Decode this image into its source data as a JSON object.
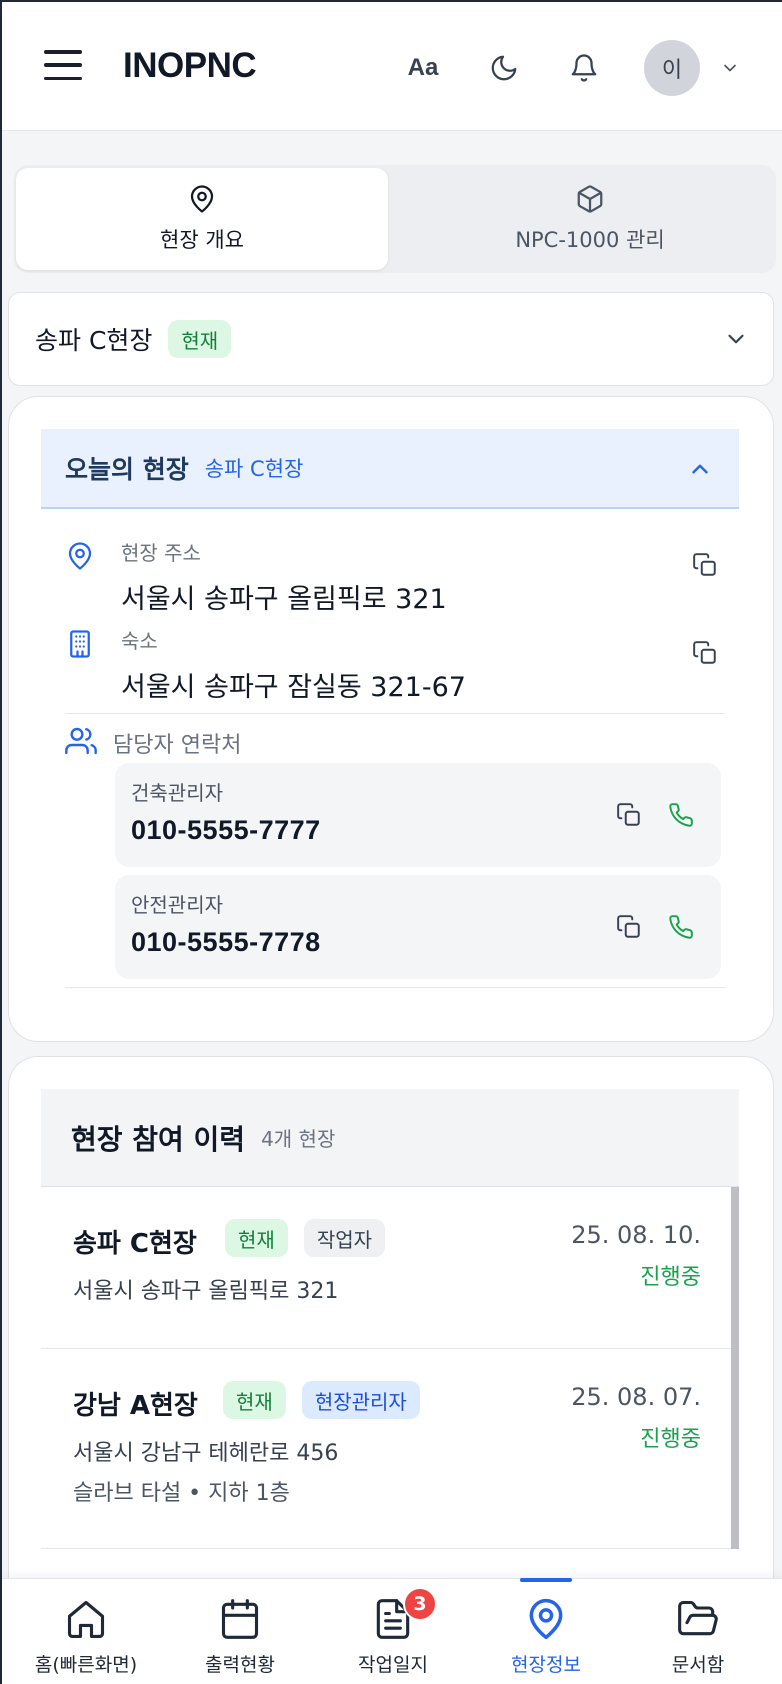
{
  "header": {
    "brand": "INOPNC",
    "font_toggle": "Aa",
    "avatar_initial": "이"
  },
  "tabs": [
    {
      "label": "현장 개요",
      "icon": "map-pin-icon",
      "active": true
    },
    {
      "label": "NPC-1000 관리",
      "icon": "package-box-icon",
      "active": false
    }
  ],
  "site_selector": {
    "site_name": "송파 C현장",
    "badge": "현재"
  },
  "today": {
    "title": "오늘의 현장",
    "site": "송파 C현장",
    "address_label": "현장 주소",
    "address": "서울시 송파구 올림픽로 321",
    "lodging_label": "숙소",
    "lodging": "서울시 송파구 잠실동 321-67",
    "contacts_label": "담당자 연락처",
    "contacts": [
      {
        "role": "건축관리자",
        "phone": "010-5555-7777"
      },
      {
        "role": "안전관리자",
        "phone": "010-5555-7778"
      }
    ]
  },
  "history": {
    "title": "현장 참여 이력",
    "count": "4개 현장",
    "items": [
      {
        "name": "송파 C현장",
        "badge_current": "현재",
        "badge_role": "작업자",
        "address": "서울시 송파구 올림픽로 321",
        "detail": "",
        "date": "25. 08. 10.",
        "status": "진행중"
      },
      {
        "name": "강남 A현장",
        "badge_current": "현재",
        "badge_role": "현장관리자",
        "address": "서울시 강남구 테헤란로 456",
        "detail": "슬라브 타설 • 지하 1층",
        "date": "25. 08. 07.",
        "status": "진행중"
      }
    ]
  },
  "nav": [
    {
      "label": "홈(빠른화면)",
      "icon": "home-icon"
    },
    {
      "label": "출력현황",
      "icon": "calendar-icon"
    },
    {
      "label": "작업일지",
      "icon": "document-icon",
      "badge": "3"
    },
    {
      "label": "현장정보",
      "icon": "map-pin-icon",
      "active": true
    },
    {
      "label": "문서함",
      "icon": "folder-open-icon"
    }
  ],
  "colors": {
    "accent": "#2563eb",
    "status_green": "#16a34a",
    "badge_red": "#ef4444"
  }
}
